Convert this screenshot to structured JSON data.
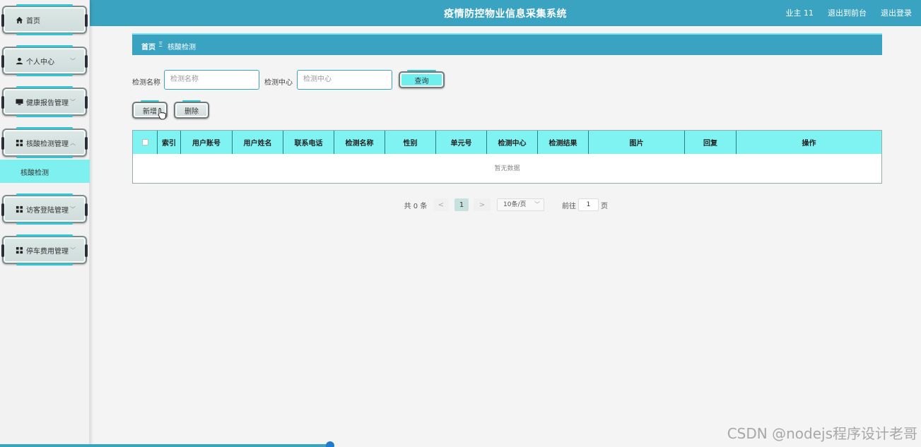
{
  "app": {
    "title": "疫情防控物业信息采集系统",
    "user": "业主 11",
    "links": [
      "退出到前台",
      "退出登录"
    ]
  },
  "sidebar": {
    "items": [
      {
        "label": "首页",
        "icon": "home-icon"
      },
      {
        "label": "个人中心",
        "icon": "user-icon"
      },
      {
        "label": "健康报告管理",
        "icon": "monitor-icon"
      },
      {
        "label": "核酸检测管理",
        "icon": "grid-icon"
      },
      {
        "label": "访客登陆管理",
        "icon": "grid-icon"
      },
      {
        "label": "停车费用管理",
        "icon": "grid-icon"
      }
    ],
    "submenu": "核酸检测"
  },
  "breadcrumb": {
    "home": "首页",
    "separator": "Ξ",
    "current": "核酸检测"
  },
  "search": {
    "name_label": "检测名称",
    "name_placeholder": "检测名称",
    "center_label": "检测中心",
    "center_placeholder": "检测中心",
    "query_button": "查询"
  },
  "actions": {
    "add": "新增",
    "delete": "删除"
  },
  "table": {
    "columns": [
      "索引",
      "用户账号",
      "用户姓名",
      "联系电话",
      "检测名称",
      "性别",
      "单元号",
      "检测中心",
      "检测结果",
      "图片",
      "回复",
      "操作"
    ],
    "empty_text": "暂无数据"
  },
  "pagination": {
    "total": "共 0 条",
    "prev": "<",
    "current_page": "1",
    "next": ">",
    "page_size": "10条/页",
    "goto_label": "前往",
    "goto_value": "1",
    "page_suffix": "页"
  },
  "watermark": "CSDN @nodejs程序设计老哥",
  "colors": {
    "primary": "#3aa3c1",
    "accent": "#7ef3f2"
  }
}
